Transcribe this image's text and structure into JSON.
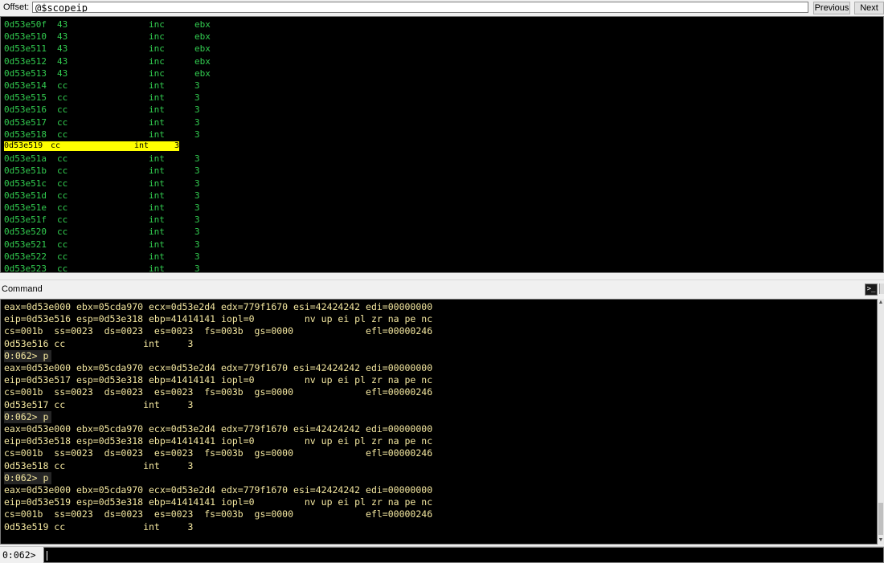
{
  "toolbar": {
    "offset_label": "Offset:",
    "offset_value": "@$scopeip",
    "previous_label": "Previous",
    "next_label": "Next"
  },
  "disassembly": {
    "rows": [
      {
        "addr": "0d53e50f",
        "bytes": "43",
        "mnemonic": "inc",
        "operand": "ebx"
      },
      {
        "addr": "0d53e510",
        "bytes": "43",
        "mnemonic": "inc",
        "operand": "ebx"
      },
      {
        "addr": "0d53e511",
        "bytes": "43",
        "mnemonic": "inc",
        "operand": "ebx"
      },
      {
        "addr": "0d53e512",
        "bytes": "43",
        "mnemonic": "inc",
        "operand": "ebx"
      },
      {
        "addr": "0d53e513",
        "bytes": "43",
        "mnemonic": "inc",
        "operand": "ebx"
      },
      {
        "addr": "0d53e514",
        "bytes": "cc",
        "mnemonic": "int",
        "operand": "3"
      },
      {
        "addr": "0d53e515",
        "bytes": "cc",
        "mnemonic": "int",
        "operand": "3"
      },
      {
        "addr": "0d53e516",
        "bytes": "cc",
        "mnemonic": "int",
        "operand": "3"
      },
      {
        "addr": "0d53e517",
        "bytes": "cc",
        "mnemonic": "int",
        "operand": "3"
      },
      {
        "addr": "0d53e518",
        "bytes": "cc",
        "mnemonic": "int",
        "operand": "3"
      },
      {
        "addr": "0d53e519",
        "bytes": "cc",
        "mnemonic": "int",
        "operand": "3",
        "current": true
      },
      {
        "addr": "0d53e51a",
        "bytes": "cc",
        "mnemonic": "int",
        "operand": "3"
      },
      {
        "addr": "0d53e51b",
        "bytes": "cc",
        "mnemonic": "int",
        "operand": "3"
      },
      {
        "addr": "0d53e51c",
        "bytes": "cc",
        "mnemonic": "int",
        "operand": "3"
      },
      {
        "addr": "0d53e51d",
        "bytes": "cc",
        "mnemonic": "int",
        "operand": "3"
      },
      {
        "addr": "0d53e51e",
        "bytes": "cc",
        "mnemonic": "int",
        "operand": "3"
      },
      {
        "addr": "0d53e51f",
        "bytes": "cc",
        "mnemonic": "int",
        "operand": "3"
      },
      {
        "addr": "0d53e520",
        "bytes": "cc",
        "mnemonic": "int",
        "operand": "3"
      },
      {
        "addr": "0d53e521",
        "bytes": "cc",
        "mnemonic": "int",
        "operand": "3"
      },
      {
        "addr": "0d53e522",
        "bytes": "cc",
        "mnemonic": "int",
        "operand": "3"
      },
      {
        "addr": "0d53e523",
        "bytes": "cc",
        "mnemonic": "int",
        "operand": "3"
      }
    ]
  },
  "command": {
    "title": "Command",
    "icon": "console-icon",
    "lines": [
      {
        "text": "eax=0d53e000 ebx=05cda970 ecx=0d53e2d4 edx=779f1670 esi=42424242 edi=00000000"
      },
      {
        "text": "eip=0d53e516 esp=0d53e318 ebp=41414141 iopl=0         nv up ei pl zr na pe nc"
      },
      {
        "text": "cs=001b  ss=0023  ds=0023  es=0023  fs=003b  gs=0000             efl=00000246"
      },
      {
        "text": "0d53e516 cc              int     3"
      },
      {
        "text": "0:062> p",
        "prompt": true
      },
      {
        "text": "eax=0d53e000 ebx=05cda970 ecx=0d53e2d4 edx=779f1670 esi=42424242 edi=00000000"
      },
      {
        "text": "eip=0d53e517 esp=0d53e318 ebp=41414141 iopl=0         nv up ei pl zr na pe nc"
      },
      {
        "text": "cs=001b  ss=0023  ds=0023  es=0023  fs=003b  gs=0000             efl=00000246"
      },
      {
        "text": "0d53e517 cc              int     3"
      },
      {
        "text": "0:062> p",
        "prompt": true
      },
      {
        "text": "eax=0d53e000 ebx=05cda970 ecx=0d53e2d4 edx=779f1670 esi=42424242 edi=00000000"
      },
      {
        "text": "eip=0d53e518 esp=0d53e318 ebp=41414141 iopl=0         nv up ei pl zr na pe nc"
      },
      {
        "text": "cs=001b  ss=0023  ds=0023  es=0023  fs=003b  gs=0000             efl=00000246"
      },
      {
        "text": "0d53e518 cc              int     3"
      },
      {
        "text": "0:062> p",
        "prompt": true
      },
      {
        "text": "eax=0d53e000 ebx=05cda970 ecx=0d53e2d4 edx=779f1670 esi=42424242 edi=00000000"
      },
      {
        "text": "eip=0d53e519 esp=0d53e318 ebp=41414141 iopl=0         nv up ei pl zr na pe nc"
      },
      {
        "text": "cs=001b  ss=0023  ds=0023  es=0023  fs=003b  gs=0000             efl=00000246"
      },
      {
        "text": "0d53e519 cc              int     3"
      }
    ],
    "input_prompt": "0:062>",
    "input_value": ""
  },
  "colors": {
    "disasm_text": "#32cd50",
    "highlight_bg": "#ffff00",
    "command_text": "#f5e8a0",
    "pane_bg": "#000000"
  }
}
